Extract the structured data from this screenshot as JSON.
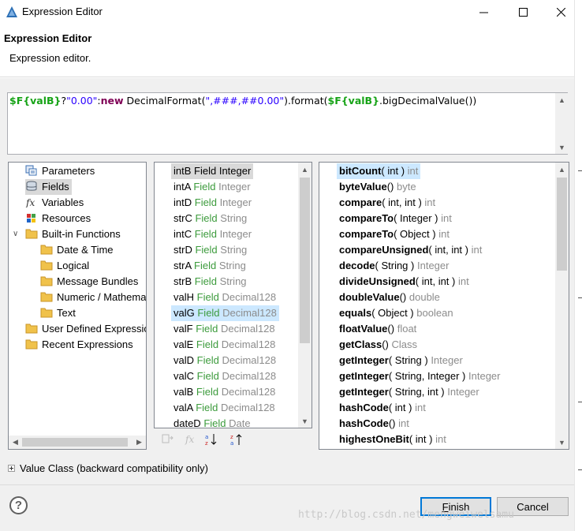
{
  "window": {
    "title": "Expression Editor",
    "minimize_glyph": "—",
    "maximize_glyph": "☐",
    "close_glyph": "✕"
  },
  "header": {
    "title": "Expression Editor",
    "description": "Expression editor."
  },
  "expression": {
    "tokens": [
      {
        "text": "$F{valB}",
        "kind": "var"
      },
      {
        "text": "?",
        "kind": "plain"
      },
      {
        "text": "\"0.00\"",
        "kind": "str"
      },
      {
        "text": ":",
        "kind": "plain"
      },
      {
        "text": "new",
        "kind": "kw"
      },
      {
        "text": " DecimalFormat(",
        "kind": "plain"
      },
      {
        "text": "\",###,##0.00\"",
        "kind": "str"
      },
      {
        "text": ").format(",
        "kind": "plain"
      },
      {
        "text": "$F{valB}",
        "kind": "var"
      },
      {
        "text": ".bigDecimalValue())",
        "kind": "plain"
      }
    ]
  },
  "categories": {
    "items": [
      {
        "label": "Parameters",
        "icon": "parameters-icon"
      },
      {
        "label": "Fields",
        "icon": "fields-icon"
      },
      {
        "label": "Variables",
        "icon": "variables-icon"
      },
      {
        "label": "Resources",
        "icon": "resources-icon"
      },
      {
        "label": "Built-in Functions",
        "icon": "folder-icon"
      },
      {
        "label": "Date & Time",
        "icon": "folder-icon"
      },
      {
        "label": "Logical",
        "icon": "folder-icon"
      },
      {
        "label": "Message Bundles",
        "icon": "folder-icon"
      },
      {
        "label": "Numeric / Mathematical",
        "icon": "folder-icon"
      },
      {
        "label": "Text",
        "icon": "folder-icon"
      },
      {
        "label": "User Defined Expressions",
        "icon": "folder-icon"
      },
      {
        "label": "Recent Expressions",
        "icon": "folder-icon"
      }
    ]
  },
  "objects": {
    "items": [
      {
        "name": "intB",
        "kind": "Field",
        "type": "Integer"
      },
      {
        "name": "intA",
        "kind": "Field",
        "type": "Integer"
      },
      {
        "name": "intD",
        "kind": "Field",
        "type": "Integer"
      },
      {
        "name": "strC",
        "kind": "Field",
        "type": "String"
      },
      {
        "name": "intC",
        "kind": "Field",
        "type": "Integer"
      },
      {
        "name": "strD",
        "kind": "Field",
        "type": "String"
      },
      {
        "name": "strA",
        "kind": "Field",
        "type": "String"
      },
      {
        "name": "strB",
        "kind": "Field",
        "type": "String"
      },
      {
        "name": "valH",
        "kind": "Field",
        "type": "Decimal128"
      },
      {
        "name": "valG",
        "kind": "Field",
        "type": "Decimal128"
      },
      {
        "name": "valF",
        "kind": "Field",
        "type": "Decimal128"
      },
      {
        "name": "valE",
        "kind": "Field",
        "type": "Decimal128"
      },
      {
        "name": "valD",
        "kind": "Field",
        "type": "Decimal128"
      },
      {
        "name": "valC",
        "kind": "Field",
        "type": "Decimal128"
      },
      {
        "name": "valB",
        "kind": "Field",
        "type": "Decimal128"
      },
      {
        "name": "valA",
        "kind": "Field",
        "type": "Decimal128"
      },
      {
        "name": "dateD",
        "kind": "Field",
        "type": "Date"
      }
    ]
  },
  "functions": {
    "items": [
      {
        "name": "bitCount",
        "args": "( int )",
        "ret": "int"
      },
      {
        "name": "byteValue",
        "args": "()",
        "ret": "byte"
      },
      {
        "name": "compare",
        "args": "( int, int )",
        "ret": "int"
      },
      {
        "name": "compareTo",
        "args": "( Integer )",
        "ret": "int"
      },
      {
        "name": "compareTo",
        "args": "( Object )",
        "ret": "int"
      },
      {
        "name": "compareUnsigned",
        "args": "( int, int )",
        "ret": "int"
      },
      {
        "name": "decode",
        "args": "( String )",
        "ret": "Integer"
      },
      {
        "name": "divideUnsigned",
        "args": "( int, int )",
        "ret": "int"
      },
      {
        "name": "doubleValue",
        "args": "()",
        "ret": "double"
      },
      {
        "name": "equals",
        "args": "( Object )",
        "ret": "boolean"
      },
      {
        "name": "floatValue",
        "args": "()",
        "ret": "float"
      },
      {
        "name": "getClass",
        "args": "()",
        "ret": "Class"
      },
      {
        "name": "getInteger",
        "args": "( String )",
        "ret": "Integer"
      },
      {
        "name": "getInteger",
        "args": "( String, Integer )",
        "ret": "Integer"
      },
      {
        "name": "getInteger",
        "args": "( String, int )",
        "ret": "Integer"
      },
      {
        "name": "hashCode",
        "args": "( int )",
        "ret": "int"
      },
      {
        "name": "hashCode",
        "args": "()",
        "ret": "int"
      },
      {
        "name": "highestOneBit",
        "args": "( int )",
        "ret": "int"
      }
    ]
  },
  "value_class": {
    "label": "Value Class (backward compatibility only)"
  },
  "footer": {
    "help_glyph": "?",
    "finish_label": "Finish",
    "cancel_label": "Cancel"
  },
  "watermark": "http://blog.csdn.net/mengweiwelsamu",
  "colors": {
    "field_kind": "#3c9b3c",
    "type_grey": "#8c8c8c",
    "var_token": "#17a317",
    "string_token": "#2a00ff",
    "keyword_token": "#7f0055",
    "selection_blue": "#cce8ff",
    "selection_grey": "#d9d9d9",
    "default_button_border": "#0078d7"
  }
}
